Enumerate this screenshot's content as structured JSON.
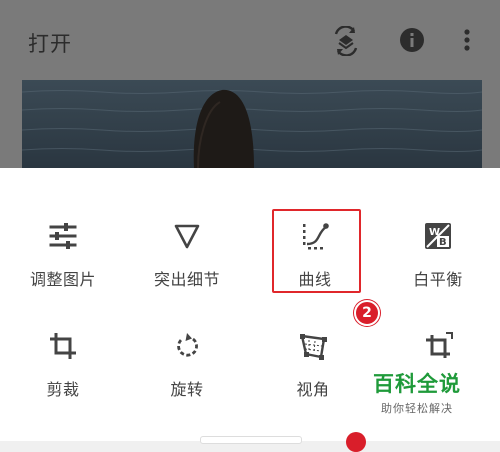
{
  "appbar": {
    "title": "打开",
    "icons": [
      "styles-layers-icon",
      "info-icon",
      "more-vert-icon"
    ]
  },
  "tools": [
    {
      "label": "调整图片",
      "icon": "tune-sliders-icon"
    },
    {
      "label": "突出细节",
      "icon": "details-triangle-icon"
    },
    {
      "label": "曲线",
      "icon": "curves-icon"
    },
    {
      "label": "白平衡",
      "icon": "white-balance-icon"
    },
    {
      "label": "剪裁",
      "icon": "crop-icon"
    },
    {
      "label": "旋转",
      "icon": "rotate-icon"
    },
    {
      "label": "视角",
      "icon": "perspective-icon"
    },
    {
      "label": "",
      "icon": "expand-crop-icon"
    }
  ],
  "annotation": {
    "step_badge": "2",
    "color": "#e0272b"
  },
  "watermark": {
    "main": "百科全说",
    "sub": "助你轻松解决"
  },
  "colors": {
    "accent": "#e0272b",
    "watermark": "#1f9a3a",
    "overlay": "#7a7a7a"
  }
}
